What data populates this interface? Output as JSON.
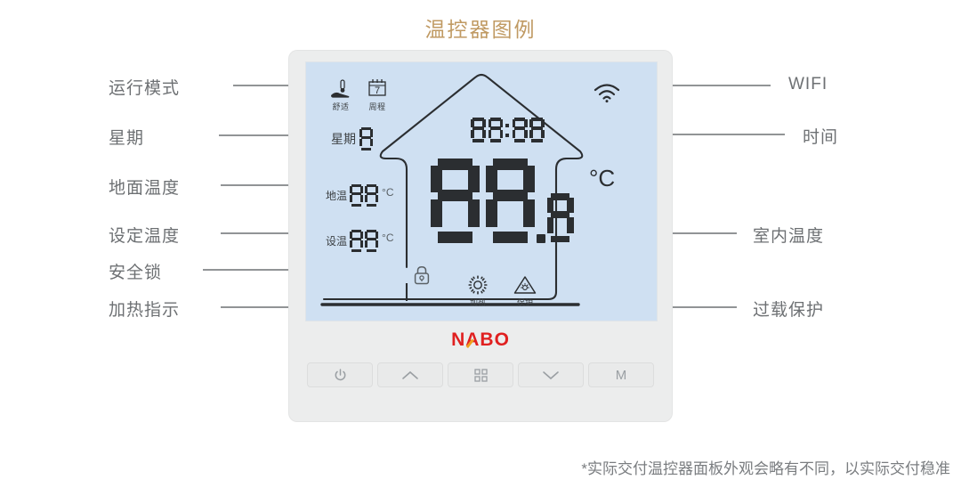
{
  "page": {
    "title": "温控器图例",
    "title_color": "#c09a63",
    "footer_note": "*实际交付温控器面板外观会略有不同，以实际交付稳准",
    "background": "#ffffff"
  },
  "device": {
    "brand": {
      "text": "NABO",
      "letters": [
        "N",
        "A",
        "B",
        "O"
      ],
      "color": "#e02020",
      "accent_color": "#f0a020"
    },
    "frame_color": "#eceded",
    "lcd_color": "#cfe0f2",
    "buttons": [
      {
        "name": "power",
        "glyph": "⏻"
      },
      {
        "name": "up",
        "glyph": "⌃"
      },
      {
        "name": "menu",
        "glyph": "▦"
      },
      {
        "name": "down",
        "glyph": "⌄"
      },
      {
        "name": "mode",
        "glyph": "M"
      }
    ]
  },
  "lcd": {
    "mode_icons": [
      {
        "icon": "comfort-thermometer-hand-icon",
        "label": "舒适"
      },
      {
        "icon": "calendar-week-icon",
        "label": "周程",
        "calendar_number": "7"
      }
    ],
    "wifi": {
      "icon": "wifi-icon"
    },
    "week": {
      "label": "星期",
      "value": "8"
    },
    "time": {
      "value": "88:88"
    },
    "floor_temp": {
      "label": "地温",
      "value": "88",
      "unit": "°C"
    },
    "set_temp": {
      "label": "设温",
      "value": "88",
      "unit": "°C"
    },
    "lock": {
      "icon": "lock-icon"
    },
    "room_temp": {
      "value": "88",
      "decimal": "8",
      "unit": "°C"
    },
    "status_icons": [
      {
        "icon": "heating-sun-icon",
        "label": "加热"
      },
      {
        "icon": "overload-protection-triangle-icon",
        "label": "保护"
      }
    ]
  },
  "annotations": {
    "dot_color": "#e8252a",
    "line_color": "#6d7073",
    "left": [
      {
        "label": "运行模式"
      },
      {
        "label": "星期"
      },
      {
        "label": "地面温度"
      },
      {
        "label": "设定温度"
      },
      {
        "label": "安全锁"
      },
      {
        "label": "加热指示"
      }
    ],
    "right": [
      {
        "label": "WIFI"
      },
      {
        "label": "时间"
      },
      {
        "label": "室内温度"
      },
      {
        "label": "过载保护"
      }
    ]
  }
}
